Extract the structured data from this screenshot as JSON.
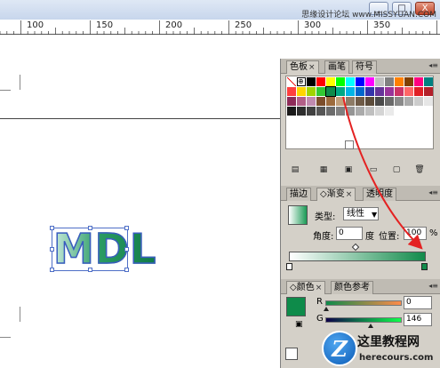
{
  "window": {
    "watermark": "思缘设计论坛 www.MISSYUAN.COM",
    "minimize_glyph": "_",
    "maximize_glyph": "□",
    "close_glyph": "X"
  },
  "ruler": {
    "labels": [
      "100",
      "150",
      "200",
      "250",
      "300",
      "350"
    ]
  },
  "canvas": {
    "artwork_text": "MDL"
  },
  "panel": {
    "swatch_tabs": [
      {
        "label": "色板",
        "close": "×"
      },
      {
        "label": "画笔",
        "close": ""
      },
      {
        "label": "符号",
        "close": ""
      }
    ],
    "gradient_tabs": [
      {
        "label": "描边",
        "close": ""
      },
      {
        "label": "渐变",
        "close": "×",
        "marker": "◇"
      },
      {
        "label": "透明度",
        "close": ""
      }
    ],
    "color_tabs": [
      {
        "label": "颜色",
        "close": "×",
        "marker": "◇"
      },
      {
        "label": "颜色参考",
        "close": ""
      }
    ],
    "swatch_colors": [
      "#ffffff",
      "#ffffff",
      "#000000",
      "#ff0000",
      "#ffff00",
      "#00ff00",
      "#00ffff",
      "#0000ff",
      "#ff00ff",
      "#c0c0c0",
      "#808080",
      "#ff8000",
      "#804000",
      "#ff0080",
      "#008080",
      "#ff3f3f",
      "#ffd500",
      "#9fd400",
      "#32c832",
      "#0e8b4a",
      "#00a884",
      "#00b4e6",
      "#0066cc",
      "#3333aa",
      "#663399",
      "#993399",
      "#cc3366",
      "#ff6666",
      "#e01f25",
      "#b3202a",
      "#8e2b59",
      "#b25f88",
      "#c08bb0",
      "#7c4d2b",
      "#9d6b3d",
      "#c2a07b",
      "#8d7b66",
      "#6e5a46",
      "#5b4b3a",
      "#4a4a4a",
      "#6a6a6a",
      "#8a8a8a",
      "#aaaaaa",
      "#cccccc",
      "#e6e6e6",
      "#1a1a1a",
      "#2d2d2d",
      "#404040",
      "#555555",
      "#6b6b6b",
      "#7f7f7f",
      "#959595",
      "#aaaaaa",
      "#bfbfbf",
      "#d4d4d4",
      "#eaeaea",
      "#ffffff",
      "#ffffff",
      "#ffffff",
      "#ffffff"
    ],
    "gradient": {
      "type_label": "类型:",
      "type_value": "线性",
      "angle_label": "角度:",
      "angle_value": "0",
      "angle_unit": "度",
      "position_label": "位置:",
      "position_value": "100",
      "percent": "%",
      "start_color": "#ffffff",
      "end_color": "#128b4b",
      "midpoint": 0.5
    },
    "color": {
      "r_label": "R",
      "r_value": "0",
      "g_label": "G",
      "g_value": "146",
      "fill_color": "#0e8b4a"
    }
  },
  "brand": {
    "logo_letter": "Z",
    "name": "这里教程网",
    "url": "herecours.com"
  }
}
